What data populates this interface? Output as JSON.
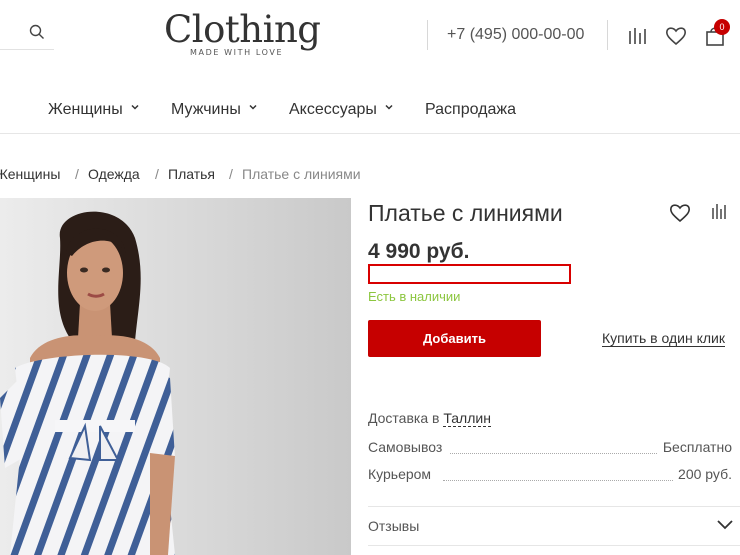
{
  "header": {
    "logo": "Clothing",
    "tagline": "MADE WITH LOVE",
    "phone": "+7 (495) 000-00-00",
    "cart_count": "0",
    "icons": [
      "search-icon",
      "compare-icon",
      "heart-icon",
      "cart-icon"
    ]
  },
  "nav": {
    "items": [
      {
        "label": "Женщины",
        "has_dropdown": true
      },
      {
        "label": "Мужчины",
        "has_dropdown": true
      },
      {
        "label": "Аксессуары",
        "has_dropdown": true
      },
      {
        "label": "Распродажа",
        "has_dropdown": false
      }
    ]
  },
  "breadcrumb": [
    "Женщины",
    "Одежда",
    "Платья",
    "Платье с линиями"
  ],
  "product": {
    "title": "Платье с линиями",
    "price": "4 990 руб.",
    "stock": "Есть в наличии",
    "add_label": "Добавить",
    "one_click": "Купить в один клик",
    "delivery_prefix": "Доставка в",
    "delivery_city": "Таллин",
    "delivery_rows": [
      {
        "label": "Самовывоз",
        "value": "Бесплатно"
      },
      {
        "label": "Курьером",
        "value": "200 руб."
      }
    ],
    "reviews_label": "Отзывы"
  },
  "colors": {
    "accent": "#c60000",
    "stock_green": "#8cc63f",
    "highlight": "#d80000"
  }
}
